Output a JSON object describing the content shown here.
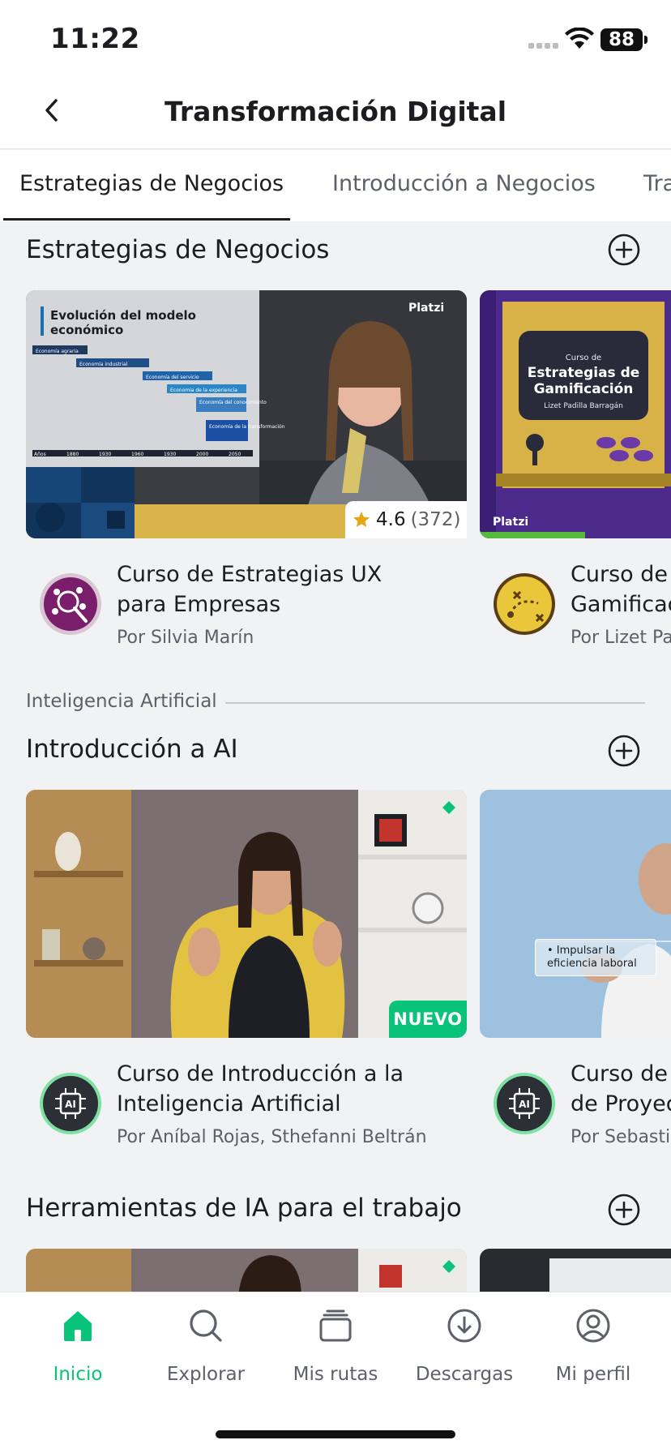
{
  "status_bar": {
    "time": "11:22",
    "battery": "88"
  },
  "header": {
    "title": "Transformación Digital"
  },
  "tabs": [
    {
      "label": "Estrategias de Negocios",
      "active": true
    },
    {
      "label": "Introducción a Negocios",
      "active": false
    },
    {
      "label": "Tra",
      "active": false
    }
  ],
  "sections": [
    {
      "title": "Estrategias de Negocios",
      "courses": [
        {
          "title_line1": "Curso de Estrategias UX",
          "title_line2": "para Empresas",
          "author": "Por Silvia Marín",
          "rating": "4.6",
          "rating_count": "(372)",
          "thumb_slide_title": "Evolución del modelo económico",
          "thumb_slide_items": [
            "Economía agraria",
            "Economía industrial",
            "Economía del servicio",
            "Economía de la experiencia",
            "Economía del conocimiento",
            "Economía de la transformación"
          ],
          "thumb_slide_axis": [
            "Años",
            "1880",
            "1930",
            "1960",
            "1930",
            "2000",
            "2050"
          ],
          "thumb_brand": "Platzi"
        },
        {
          "title_line1": "Curso de E",
          "title_line2": "Gamificac",
          "author": "Por Lizet Pa",
          "thumb_small": "Curso de",
          "thumb_title": "Estrategias de Gamificación",
          "thumb_author": "Lizet Padilla Barragán",
          "thumb_brand": "Platzi"
        }
      ]
    },
    {
      "category": "Inteligencia Artificial",
      "title": "Introducción a AI",
      "courses": [
        {
          "title_line1": "Curso de Introducción a la",
          "title_line2": "Inteligencia Artificial",
          "author": "Por Aníbal Rojas, Sthefanni Beltrán",
          "badge": "NUEVO",
          "icon_text": "AI"
        },
        {
          "title_line1": "Curso de I",
          "title_line2": "de Proyec",
          "author": "Por Sebasti",
          "icon_text": "AI",
          "thumb_bullet": "• Impulsar la eficiencia laboral"
        }
      ]
    },
    {
      "title": "Herramientas de IA para el trabajo"
    }
  ],
  "bottom_nav": [
    {
      "label": "Inicio",
      "icon": "home-icon",
      "active": true
    },
    {
      "label": "Explorar",
      "icon": "search-icon",
      "active": false
    },
    {
      "label": "Mis rutas",
      "icon": "stack-icon",
      "active": false
    },
    {
      "label": "Descargas",
      "icon": "download-icon",
      "active": false
    },
    {
      "label": "Mi perfil",
      "icon": "profile-icon",
      "active": false
    }
  ],
  "colors": {
    "accent": "#0ac37a",
    "text": "#1c1d20",
    "muted": "#5c6068",
    "background": "#f1f2f4"
  }
}
